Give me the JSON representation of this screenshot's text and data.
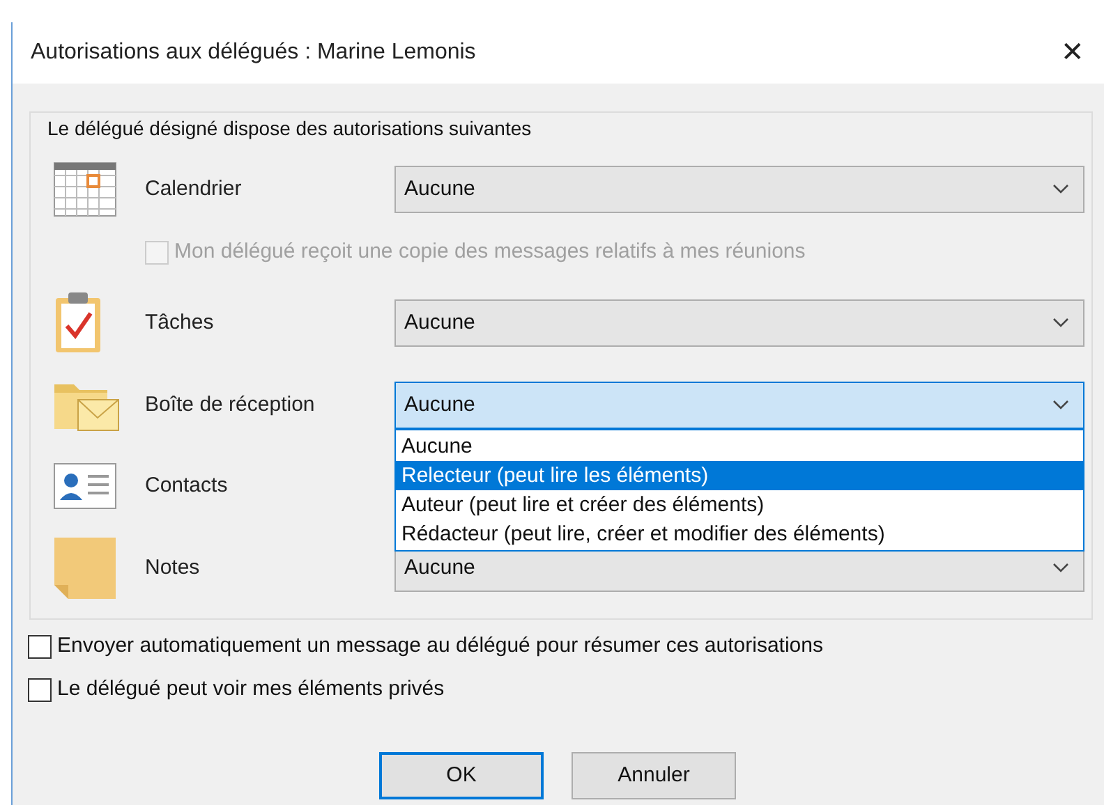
{
  "window": {
    "title": "Autorisations aux délégués : Marine Lemonis",
    "close_glyph": "✕"
  },
  "group": {
    "label": "Le délégué désigné dispose des autorisations suivantes"
  },
  "permissions": [
    {
      "kind": "calendar",
      "label": "Calendrier",
      "value": "Aucune",
      "focused": false,
      "sub_checkbox": {
        "label": "Mon délégué reçoit une copie des messages relatifs à mes réunions",
        "checked": false,
        "disabled": true
      }
    },
    {
      "kind": "tasks",
      "label": "Tâches",
      "value": "Aucune",
      "focused": false
    },
    {
      "kind": "inbox",
      "label": "Boîte de réception",
      "value": "Aucune",
      "focused": true,
      "options": [
        {
          "label": "Aucune",
          "highlighted": false
        },
        {
          "label": "Relecteur (peut lire les éléments)",
          "highlighted": true
        },
        {
          "label": "Auteur (peut lire et créer des éléments)",
          "highlighted": false
        },
        {
          "label": "Rédacteur (peut lire, créer et modifier des éléments)",
          "highlighted": false
        }
      ]
    },
    {
      "kind": "contacts",
      "label": "Contacts"
    },
    {
      "kind": "notes",
      "label": "Notes",
      "value": "Aucune",
      "focused": false
    }
  ],
  "options": [
    {
      "label": "Envoyer automatiquement un message au délégué pour résumer ces autorisations",
      "checked": false
    },
    {
      "label": "Le délégué peut voir mes éléments privés",
      "checked": false
    }
  ],
  "buttons": [
    {
      "label": "OK",
      "default": true
    },
    {
      "label": "Annuler",
      "default": false
    }
  ]
}
